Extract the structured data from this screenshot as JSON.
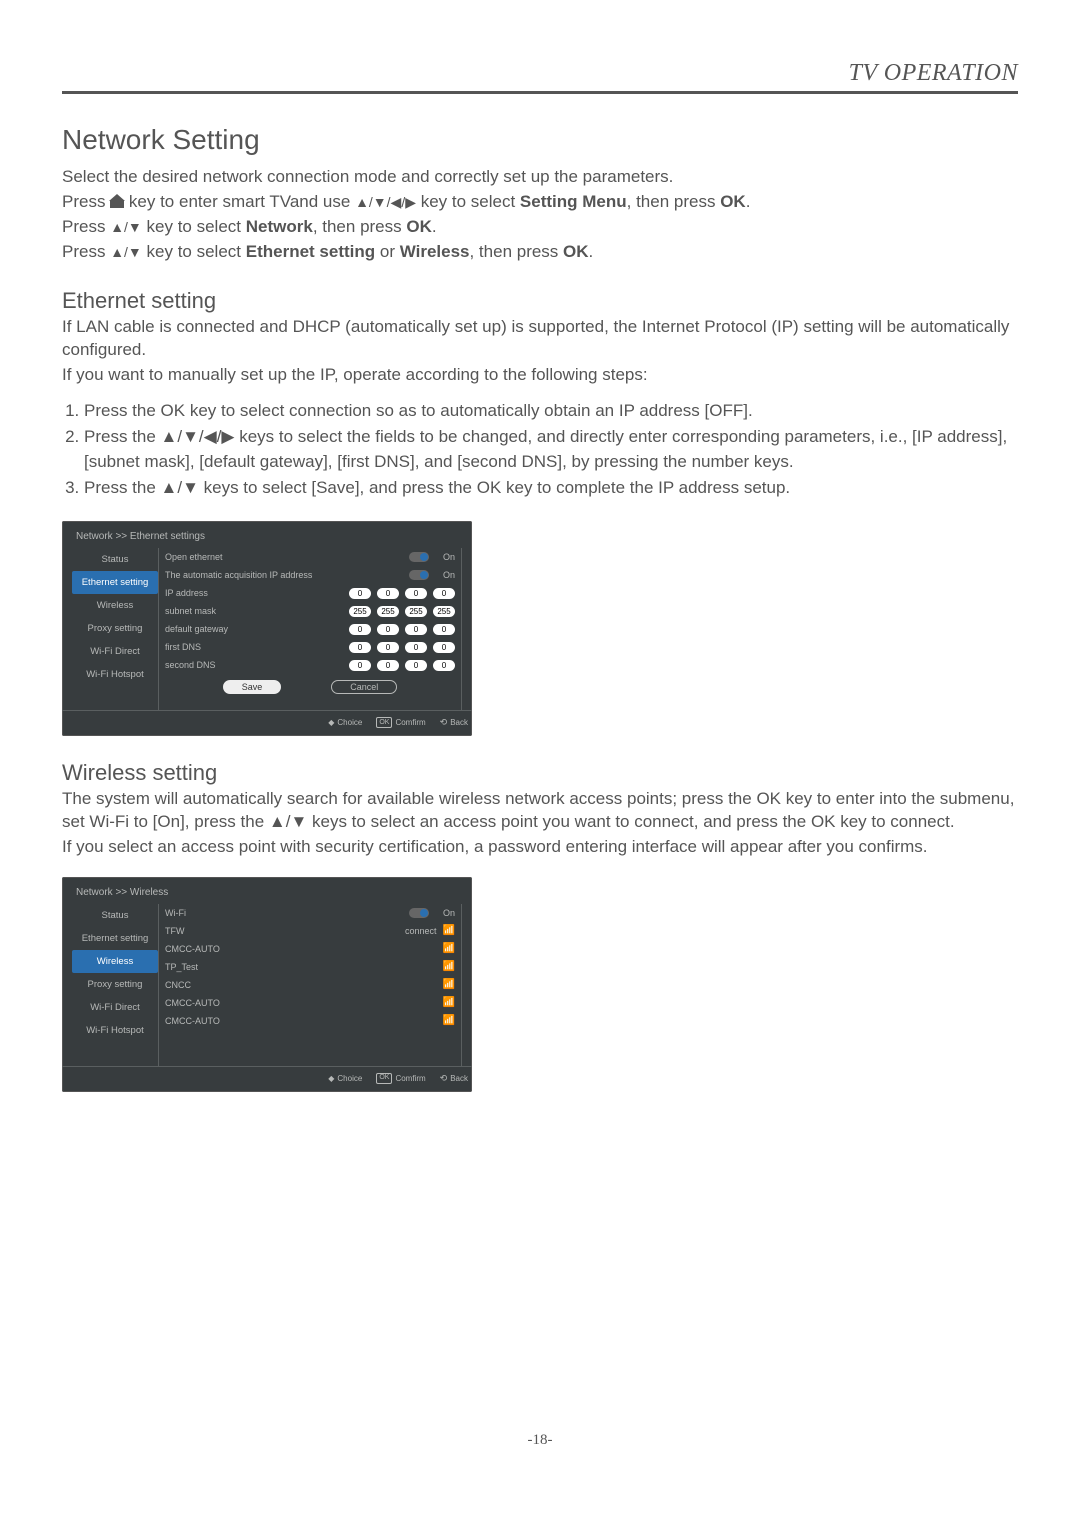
{
  "header": {
    "title": "TV OPERATION"
  },
  "section1": {
    "heading": "Network Setting",
    "p1": "Select the desired network connection mode and correctly set up the parameters.",
    "p2a": "Press ",
    "p2b": " key to enter smart TVand use ",
    "p2c": " key to select ",
    "p2d": "Setting Menu",
    "p2e": ", then press ",
    "p2f": "OK",
    "p2g": ".",
    "p3a": "Press ",
    "p3b": " key to select ",
    "p3c": "Network",
    "p3d": ", then press ",
    "p3e": "OK",
    "p3f": ".",
    "p4a": "Press ",
    "p4b": " key to select ",
    "p4c": "Ethernet setting",
    "p4d": " or ",
    "p4e": "Wireless",
    "p4f": ", then press ",
    "p4g": "OK",
    "p4h": "."
  },
  "ethernet": {
    "heading": "Ethernet setting",
    "p1": "If LAN cable is connected and DHCP (automatically set up) is supported, the Internet Protocol (IP) setting will be automatically configured.",
    "p2": "If you want to manually set up the IP, operate according to the following steps:",
    "steps": [
      "Press the OK key to select connection so as to automatically obtain an IP address [OFF].",
      "Press the ▲/▼/◀/▶ keys to select the fields to be changed, and directly enter corresponding parameters, i.e., [IP address], [subnet mask], [default gateway], [first DNS], and [second DNS], by pressing the number keys.",
      "Press the ▲/▼ keys to select [Save], and press the OK key to complete the IP address setup."
    ]
  },
  "eth_menu": {
    "crumb": "Network >> Ethernet settings",
    "sidebar": [
      "Status",
      "Ethernet setting",
      "Wireless",
      "Proxy setting",
      "Wi-Fi Direct",
      "Wi-Fi Hotspot"
    ],
    "active_index": 1,
    "rows": [
      {
        "label": "Open ethernet",
        "type": "toggle",
        "value": "On"
      },
      {
        "label": "The automatic acquisition IP address",
        "type": "toggle",
        "value": "On"
      },
      {
        "label": "IP address",
        "type": "ip",
        "ip": [
          "0",
          "0",
          "0",
          "0"
        ]
      },
      {
        "label": "subnet mask",
        "type": "ip",
        "ip": [
          "255",
          "255",
          "255",
          "255"
        ]
      },
      {
        "label": "default gateway",
        "type": "ip",
        "ip": [
          "0",
          "0",
          "0",
          "0"
        ]
      },
      {
        "label": "first DNS",
        "type": "ip",
        "ip": [
          "0",
          "0",
          "0",
          "0"
        ]
      },
      {
        "label": "second DNS",
        "type": "ip",
        "ip": [
          "0",
          "0",
          "0",
          "0"
        ]
      }
    ],
    "save": "Save",
    "cancel": "Cancel",
    "hints": {
      "choice": "Choice",
      "confirm": "Comfirm",
      "back": "Back"
    }
  },
  "wireless": {
    "heading": "Wireless setting",
    "p1": "The system will automatically search for available wireless network access points; press the OK key to enter into the submenu, set Wi-Fi to [On], press the ▲/▼ keys to select an access point you want to connect, and press the OK key to connect.",
    "p2": "If you select an access point with security certification, a password entering interface will appear after you confirms."
  },
  "wifi_menu": {
    "crumb": "Network >> Wireless",
    "sidebar": [
      "Status",
      "Ethernet setting",
      "Wireless",
      "Proxy setting",
      "Wi-Fi Direct",
      "Wi-Fi Hotspot"
    ],
    "active_index": 2,
    "rows": [
      {
        "label": "Wi-Fi",
        "type": "toggle",
        "value": "On"
      },
      {
        "label": "TFW",
        "type": "ap",
        "status": "connect"
      },
      {
        "label": "CMCC-AUTO",
        "type": "ap"
      },
      {
        "label": "TP_Test",
        "type": "ap"
      },
      {
        "label": "CNCC",
        "type": "ap"
      },
      {
        "label": "CMCC-AUTO",
        "type": "ap"
      },
      {
        "label": "CMCC-AUTO",
        "type": "ap"
      }
    ],
    "hints": {
      "choice": "Choice",
      "confirm": "Comfirm",
      "back": "Back"
    }
  },
  "page_number": "-18-"
}
